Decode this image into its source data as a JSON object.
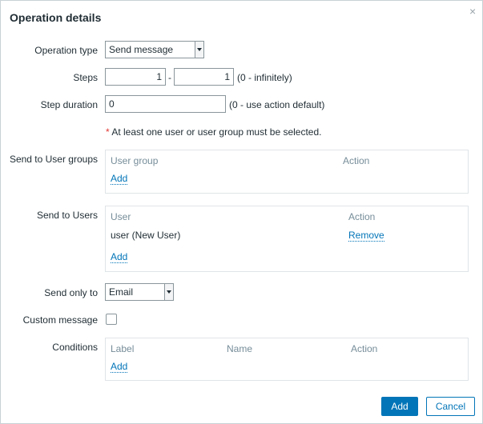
{
  "dialog": {
    "title": "Operation details",
    "close_glyph": "×"
  },
  "operation_type": {
    "label": "Operation type",
    "value": "Send message"
  },
  "steps": {
    "label": "Steps",
    "from": "1",
    "separator": "-",
    "to": "1",
    "hint": "(0 - infinitely)"
  },
  "step_duration": {
    "label": "Step duration",
    "value": "0",
    "hint": "(0 - use action default)"
  },
  "notice": {
    "asterisk": "*",
    "text": "At least one user or user group must be selected."
  },
  "user_groups": {
    "label": "Send to User groups",
    "columns": [
      "User group",
      "Action"
    ],
    "add_label": "Add"
  },
  "users": {
    "label": "Send to Users",
    "columns": [
      "User",
      "Action"
    ],
    "rows": [
      {
        "user": "user (New User)",
        "action": "Remove"
      }
    ],
    "add_label": "Add"
  },
  "send_only_to": {
    "label": "Send only to",
    "value": "Email"
  },
  "custom_message": {
    "label": "Custom message",
    "checked": false
  },
  "conditions": {
    "label": "Conditions",
    "columns": [
      "Label",
      "Name",
      "Action"
    ],
    "add_label": "Add"
  },
  "footer": {
    "add_label": "Add",
    "cancel_label": "Cancel"
  },
  "colors": {
    "accent": "#0275b8",
    "required": "#e33734"
  },
  "icons": {
    "close": "close-icon",
    "dropdown": "chevron-down-icon"
  }
}
